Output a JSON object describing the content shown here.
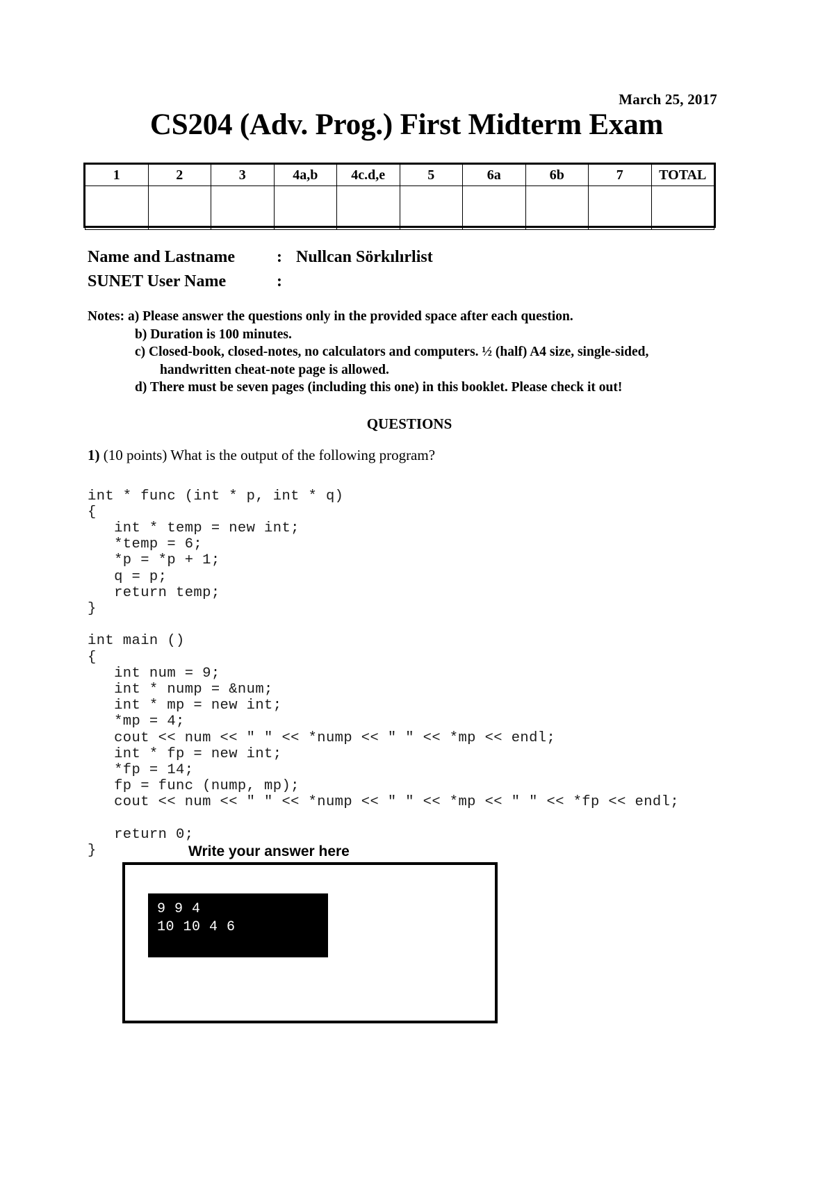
{
  "header": {
    "date": "March 25, 2017",
    "title": "CS204 (Adv. Prog.) First Midterm Exam"
  },
  "grade_table": {
    "columns": [
      "1",
      "2",
      "3",
      "4a,b",
      "4c.d,e",
      "5",
      "6a",
      "6b",
      "7",
      "TOTAL"
    ],
    "values": [
      "",
      "",
      "",
      "",
      "",
      "",
      "",
      "",
      "",
      ""
    ]
  },
  "fields": {
    "name_label": "Name and Lastname",
    "name_colon": ":",
    "name_value": "Nullcan Sörkılırlist",
    "sunet_label": "SUNET User Name",
    "sunet_colon": ":",
    "sunet_value": ""
  },
  "notes": {
    "lead": "Notes:",
    "a": "a) Please answer the questions only in the provided space after each question.",
    "b": "b) Duration is 100 minutes.",
    "c1": "c) Closed-book, closed-notes, no calculators and computers. ½ (half) A4 size, single-sided,",
    "c2": "handwritten cheat-note page is allowed.",
    "d": "d) There must be seven pages (including this one) in this booklet. Please check it out!"
  },
  "questions_header": "QUESTIONS",
  "question1": {
    "number": "1)",
    "points": "(10 points)",
    "prompt": "What is the output of the following program?",
    "code": "int * func (int * p, int * q)\n{\n   int * temp = new int;\n   *temp = 6;\n   *p = *p + 1;\n   q = p;\n   return temp;\n}\n\nint main ()\n{\n   int num = 9;\n   int * nump = &num;\n   int * mp = new int;\n   *mp = 4;\n   cout << num << \" \" << *nump << \" \" << *mp << endl;\n   int * fp = new int;\n   *fp = 14;\n   fp = func (nump, mp);\n   cout << num << \" \" << *nump << \" \" << *mp << \" \" << *fp << endl;\n\n   return 0;\n}",
    "answer_label": "Write your answer here",
    "terminal_output": "9 9 4\n10 10 4 6"
  }
}
